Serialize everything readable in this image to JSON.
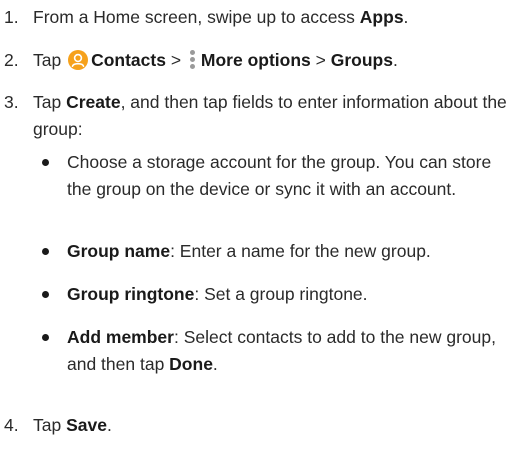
{
  "steps": [
    {
      "number": "1.",
      "pre": "From a Home screen, swipe up to access ",
      "bold": "Apps",
      "post": "."
    },
    {
      "number": "2.",
      "pre": "Tap ",
      "contacts": "Contacts",
      "sep1": " > ",
      "more_options": "More options",
      "sep2": " > ",
      "groups": "Groups",
      "post": "."
    },
    {
      "number": "3.",
      "pre": "Tap ",
      "create": "Create",
      "post": ", and then tap fields to enter information about the group:"
    },
    {
      "number": "4.",
      "pre": "Tap ",
      "save": "Save",
      "post": "."
    }
  ],
  "bullets": [
    {
      "bold": "",
      "text": "Choose a storage account for the group. You can store the group on the device or sync it with an account."
    },
    {
      "bold": "Group name",
      "text": ": Enter a name for the new group."
    },
    {
      "bold": "Group ringtone",
      "text": ": Set a group ringtone."
    },
    {
      "bold": "Add member",
      "text": ": Select contacts to add to the new group, and then tap ",
      "bold2": "Done",
      "post": "."
    }
  ],
  "icons": {
    "contacts": "contacts-app-icon",
    "more_options": "more-options-icon"
  },
  "colors": {
    "contacts_icon": "#f6a11b",
    "more_options_icon": "#9a9a9a"
  }
}
